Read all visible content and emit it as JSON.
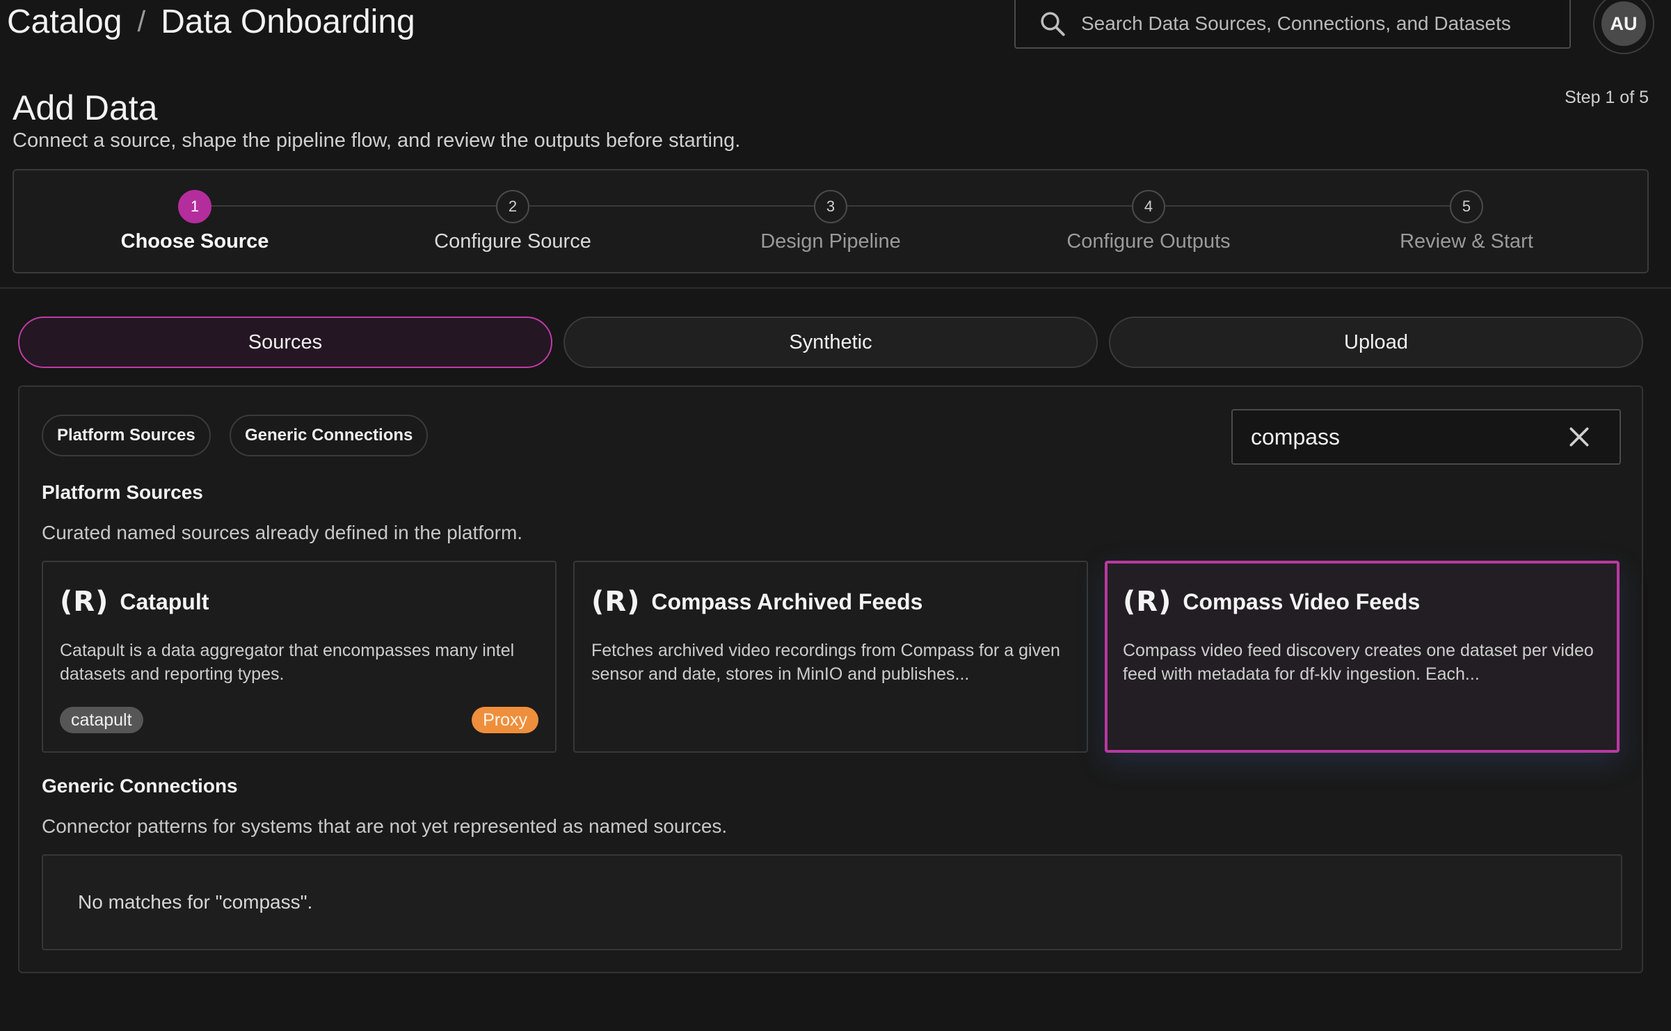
{
  "header": {
    "breadcrumb": [
      "Catalog",
      "Data Onboarding"
    ],
    "breadcrumb_separator": "/",
    "search_placeholder": "Search Data Sources, Connections, and Datasets",
    "avatar_initials": "AU"
  },
  "page": {
    "title": "Add Data",
    "subtitle": "Connect a source, shape the pipeline flow, and review the outputs before starting.",
    "step_count": "Step 1 of 5"
  },
  "stepper": {
    "steps": [
      {
        "num": "1",
        "label": "Choose Source",
        "state": "active"
      },
      {
        "num": "2",
        "label": "Configure Source",
        "state": "upcoming"
      },
      {
        "num": "3",
        "label": "Design Pipeline",
        "state": "upcoming"
      },
      {
        "num": "4",
        "label": "Configure Outputs",
        "state": "upcoming"
      },
      {
        "num": "5",
        "label": "Review & Start",
        "state": "upcoming"
      }
    ]
  },
  "mode_tabs": {
    "items": [
      {
        "label": "Sources",
        "active": true
      },
      {
        "label": "Synthetic",
        "active": false
      },
      {
        "label": "Upload",
        "active": false
      }
    ]
  },
  "filters": {
    "chips": [
      "Platform Sources",
      "Generic Connections"
    ],
    "query": "compass"
  },
  "platform_sources": {
    "title": "Platform Sources",
    "description": "Curated named sources already defined in the platform.",
    "logo_text": "(R)",
    "cards": [
      {
        "name": "Catapult",
        "description": "Catapult is a data aggregator that encompasses many intel datasets and reporting types.",
        "tag": "catapult",
        "badge": "Proxy",
        "selected": false
      },
      {
        "name": "Compass Archived Feeds",
        "description": "Fetches archived video recordings from Compass for a given sensor and date, stores in MinIO and publishes...",
        "selected": false
      },
      {
        "name": "Compass Video Feeds",
        "description": "Compass video feed discovery creates one dataset per video feed with metadata for df-klv ingestion. Each...",
        "selected": true
      }
    ]
  },
  "generic_connections": {
    "title": "Generic Connections",
    "description": "Connector patterns for systems that are not yet represented as named sources.",
    "empty_message": "No matches for \"compass\"."
  },
  "colors": {
    "accent": "#b42d9c",
    "badge_orange": "#ef8f3c",
    "background": "#161616"
  },
  "icons": {
    "search": "search-icon",
    "clear": "close-icon"
  }
}
